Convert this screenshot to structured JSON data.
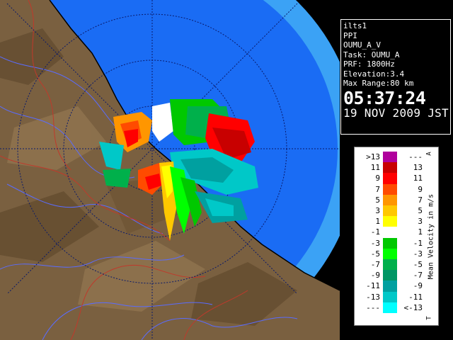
{
  "radar": {
    "product": "PPI",
    "colors": {
      "sea_inner": "#1a6cf4",
      "sea_outer": "#3ba2f5",
      "land": "#7a6040",
      "river": "#5a6cff",
      "boundary": "#c0392b"
    }
  },
  "info_panel": {
    "lines": [
      "ilts1",
      "PPI",
      "OUMU_A_V",
      "Task: OUMU_A",
      "PRF: 1800Hz",
      "Elevation:3.4",
      "Max Range:80 km"
    ],
    "time": "05:37:24",
    "date": "19 NOV 2009 JST"
  },
  "legend": {
    "title": "Mean Velocity in m/s",
    "top_mark": "A",
    "bottom_mark": "T",
    "rows": [
      {
        "left": ">13",
        "right": "---",
        "color": "#b0009c"
      },
      {
        "left": "11",
        "right": "13",
        "color": "#c80000"
      },
      {
        "left": "9",
        "right": "11",
        "color": "#ff0000"
      },
      {
        "left": "7",
        "right": "9",
        "color": "#ff4b00"
      },
      {
        "left": "5",
        "right": "7",
        "color": "#ff9600"
      },
      {
        "left": "3",
        "right": "5",
        "color": "#ffc800"
      },
      {
        "left": "1",
        "right": "3",
        "color": "#ffff00"
      },
      {
        "left": "-1",
        "right": "1",
        "color": "#ffffff"
      },
      {
        "left": "-3",
        "right": "-1",
        "color": "#00c800"
      },
      {
        "left": "-5",
        "right": "-3",
        "color": "#00ff00"
      },
      {
        "left": "-7",
        "right": "-5",
        "color": "#00b04b"
      },
      {
        "left": "-9",
        "right": "-7",
        "color": "#009664"
      },
      {
        "left": "-11",
        "right": "-9",
        "color": "#00a0a0"
      },
      {
        "left": "-13",
        "right": "-11",
        "color": "#00c8c8"
      },
      {
        "left": "---",
        "right": "<-13",
        "color": "#00ffff"
      }
    ]
  }
}
